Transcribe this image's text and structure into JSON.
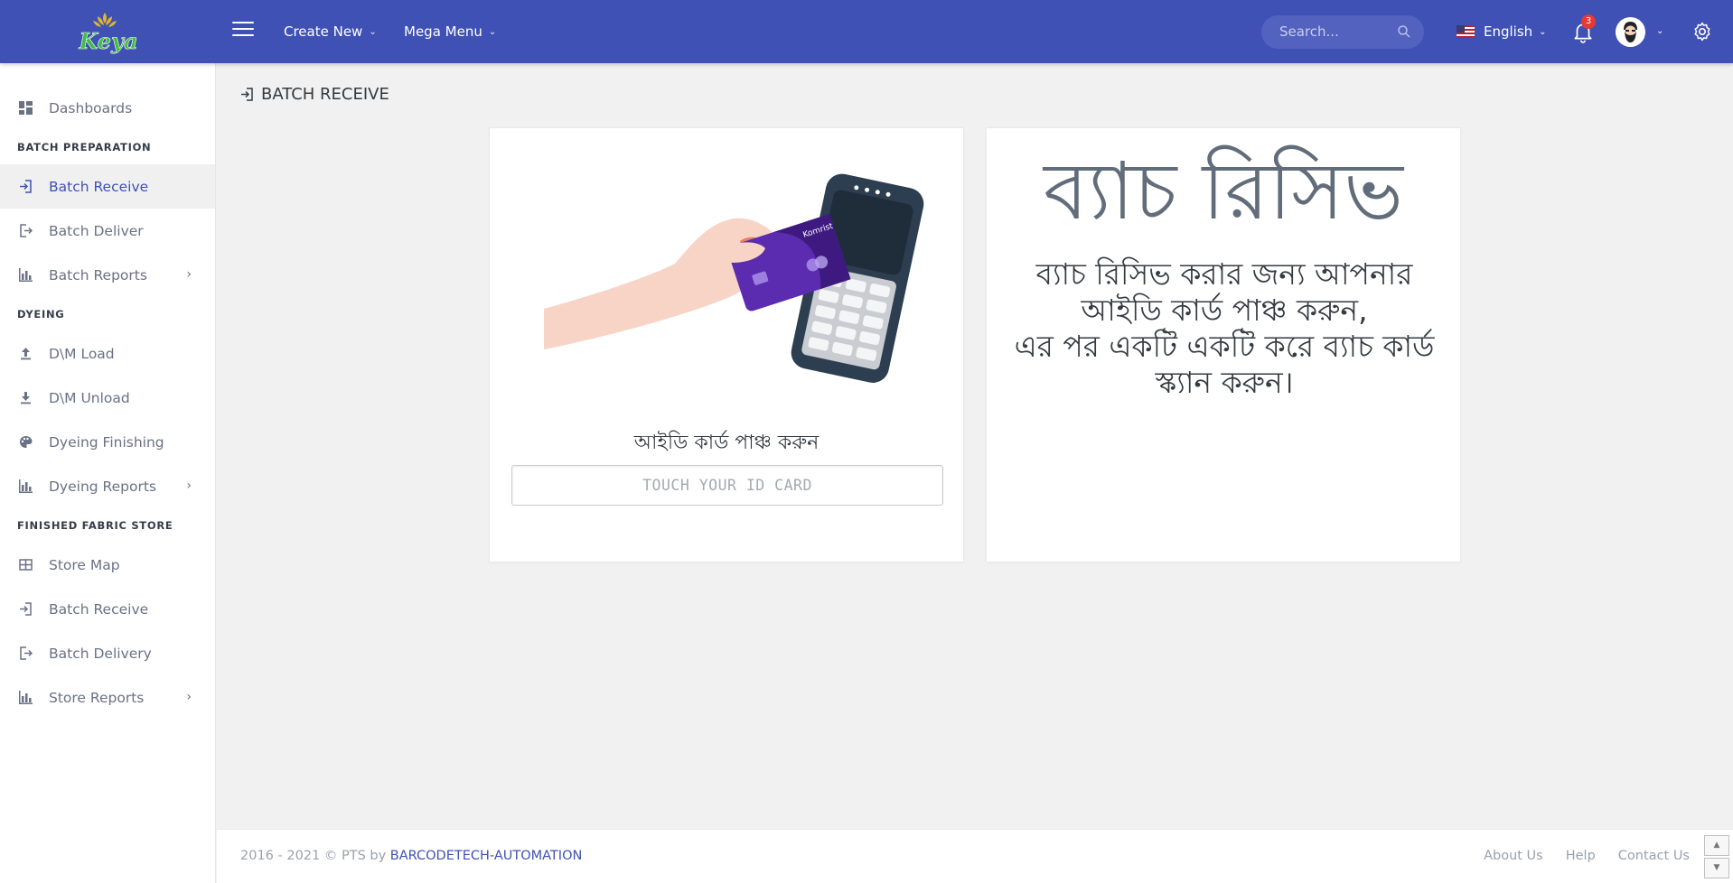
{
  "header": {
    "logo_text": "Keya",
    "nav": [
      {
        "label": "Create New"
      },
      {
        "label": "Mega Menu"
      }
    ],
    "search": {
      "placeholder": "Search..."
    },
    "language": "English",
    "notification_count": "3",
    "brand_color": "#3f51b5"
  },
  "sidebar": {
    "dashboards": "Dashboards",
    "sections": {
      "batch_preparation": "BATCH PREPARATION",
      "dyeing": "DYEING",
      "finished_fabric_store": "FINISHED FABRIC STORE"
    },
    "batch_prep_items": [
      "Batch Receive",
      "Batch Deliver",
      "Batch Reports"
    ],
    "dyeing_items": [
      "D\\M Load",
      "D\\M Unload",
      "Dyeing Finishing",
      "Dyeing Reports"
    ],
    "store_items": [
      "Store Map",
      "Batch Receive",
      "Batch Delivery",
      "Store Reports"
    ],
    "active_item": "Batch Receive"
  },
  "page": {
    "title": "BATCH RECEIVE"
  },
  "left_card": {
    "card_brand": "Komrist",
    "label": "আইডি কার্ড পাঞ্চ করুন",
    "input_placeholder": "TOUCH YOUR ID CARD",
    "input_value": ""
  },
  "right_card": {
    "title": "ব্যাচ রিসিভ",
    "line1": "ব্যাচ রিসিভ করার জন্য আপনার আইডি কার্ড পাঞ্চ করুন,",
    "line2": "এর পর একটি একটি করে ব্যাচ কার্ড স্ক্যান করুন।"
  },
  "footer": {
    "copyright": "2016 - 2021 © PTS by",
    "company_link": "BARCODETECH-AUTOMATION",
    "links": [
      "About Us",
      "Help",
      "Contact Us"
    ]
  }
}
